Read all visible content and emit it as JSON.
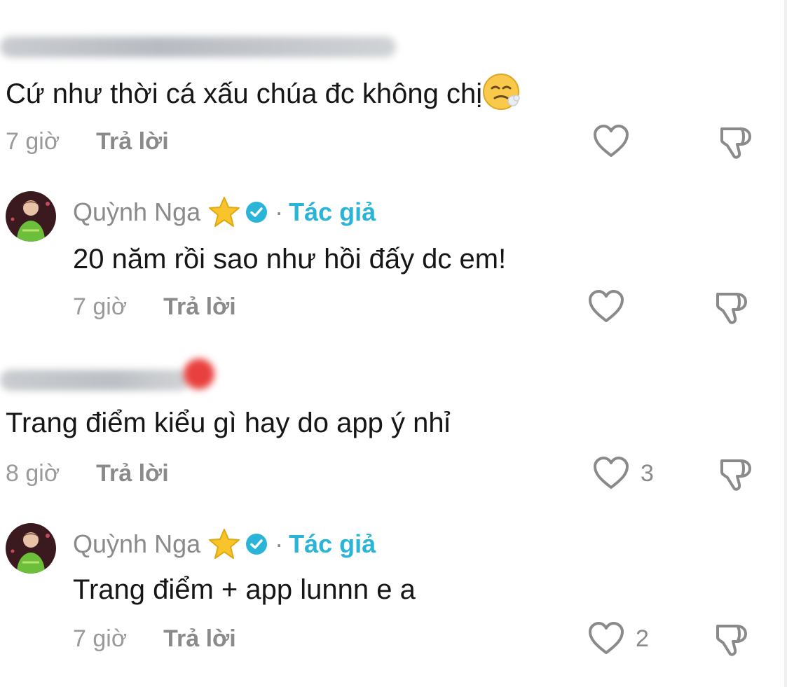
{
  "comments": [
    {
      "username_hidden": true,
      "text": "Cứ như thời cá xấu chúa đc không chị",
      "emoji": "tired-face-emoji",
      "time": "7 giờ",
      "reply": "Trả lời",
      "likes": ""
    },
    {
      "username": "Quỳnh Nga",
      "badge": "star-icon",
      "author_label": "Tác giả",
      "dot": "·",
      "text": "20 năm rồi sao như hồi đấy dc em!",
      "time": "7 giờ",
      "reply": "Trả lời",
      "likes": ""
    },
    {
      "username_hidden": true,
      "text": "Trang điểm kiểu gì hay do app ý nhỉ",
      "time": "8 giờ",
      "reply": "Trả lời",
      "likes": "3"
    },
    {
      "username": "Quỳnh Nga",
      "badge": "star-icon",
      "author_label": "Tác giả",
      "dot": "·",
      "text": "Trang điểm + app lunnn e a",
      "time": "7 giờ",
      "reply": "Trả lời",
      "likes": "2"
    }
  ],
  "colors": {
    "author": "#2ab4d7",
    "muted": "#8a8a8a",
    "text": "#161616"
  }
}
